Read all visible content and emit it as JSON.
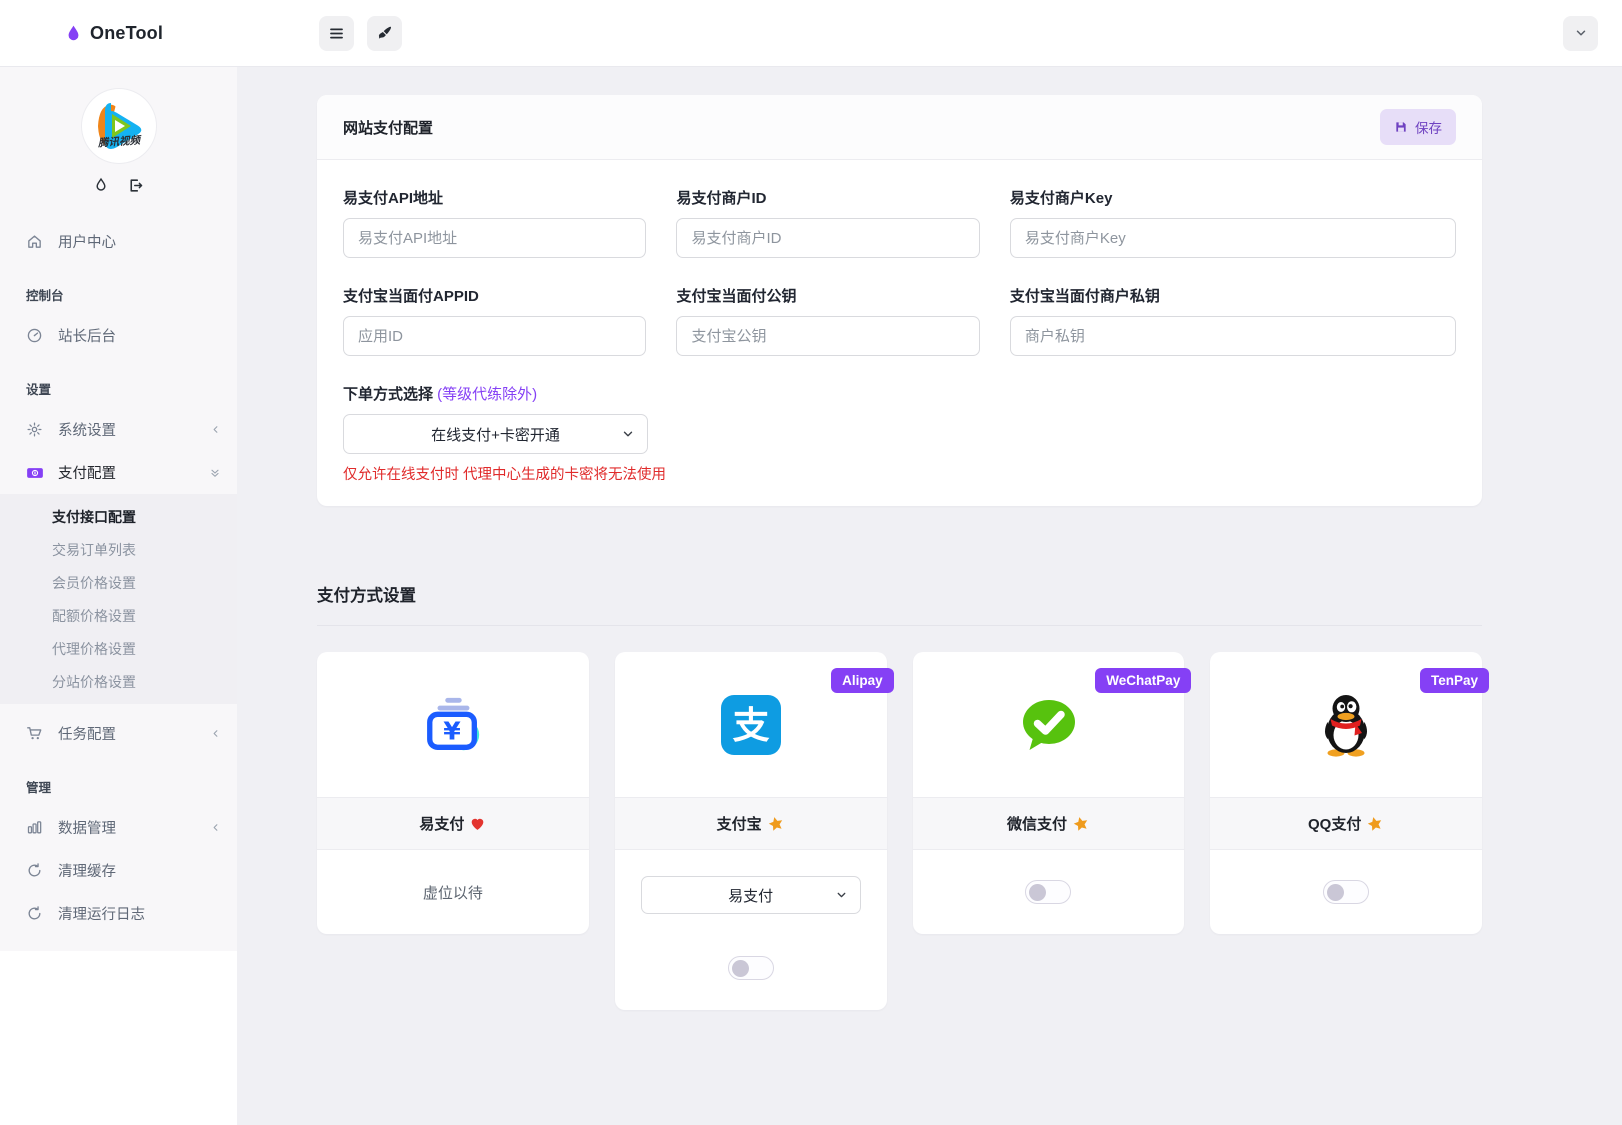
{
  "topbar": {
    "brand": "OneTool"
  },
  "sidebar": {
    "avatar_caption": "腾讯视频",
    "items": [
      {
        "label": "用户中心"
      },
      {
        "label": "控制台"
      },
      {
        "label": "站长后台"
      },
      {
        "label": "设置"
      },
      {
        "label": "系统设置"
      },
      {
        "label": "支付配置"
      },
      {
        "label": "任务配置"
      },
      {
        "label": "管理"
      },
      {
        "label": "数据管理"
      },
      {
        "label": "清理缓存"
      },
      {
        "label": "清理运行日志"
      }
    ],
    "payment_submenu": [
      {
        "label": "支付接口配置",
        "active": true
      },
      {
        "label": "交易订单列表",
        "active": false
      },
      {
        "label": "会员价格设置",
        "active": false
      },
      {
        "label": "配额价格设置",
        "active": false
      },
      {
        "label": "代理价格设置",
        "active": false
      },
      {
        "label": "分站价格设置",
        "active": false
      }
    ]
  },
  "config_card": {
    "title": "网站支付配置",
    "save_label": "保存",
    "fields": [
      {
        "label": "易支付API地址",
        "placeholder": "易支付API地址",
        "value": ""
      },
      {
        "label": "易支付商户ID",
        "placeholder": "易支付商户ID",
        "value": ""
      },
      {
        "label": "易支付商户Key",
        "placeholder": "易支付商户Key",
        "value": ""
      },
      {
        "label": "支付宝当面付APPID",
        "placeholder": "应用ID",
        "value": ""
      },
      {
        "label": "支付宝当面付公钥",
        "placeholder": "支付宝公钥",
        "value": ""
      },
      {
        "label": "支付宝当面付商户私钥",
        "placeholder": "商户私钥",
        "value": ""
      }
    ],
    "order_mode": {
      "label": "下单方式选择 ",
      "note": "(等级代练除外)",
      "selected": "在线支付+卡密开通",
      "warning": "仅允许在线支付时 代理中心生成的卡密将无法使用"
    }
  },
  "methods": {
    "title": "支付方式设置",
    "cards": [
      {
        "name": "易支付",
        "decor": "heart",
        "body_text": "虚位以待"
      },
      {
        "name": "支付宝",
        "decor": "star",
        "badge": "Alipay",
        "select_value": "易支付",
        "toggle_on": false
      },
      {
        "name": "微信支付",
        "decor": "star",
        "badge": "WeChatPay",
        "toggle_on": false
      },
      {
        "name": "QQ支付",
        "decor": "star",
        "badge": "TenPay",
        "toggle_on": false
      }
    ]
  },
  "colors": {
    "accent_purple": "#8540f5",
    "save_button_bg": "#e7def8",
    "save_button_text": "#6f42c1",
    "warning_red": "#e02b2b",
    "star_orange": "#ef9b1d",
    "heart_red": "#e3342f",
    "alipay_blue": "#0e9ce2",
    "wechat_green": "#57c20e",
    "yipay_blue": "#1b5cff",
    "yipay_teal": "#40e8dc"
  }
}
